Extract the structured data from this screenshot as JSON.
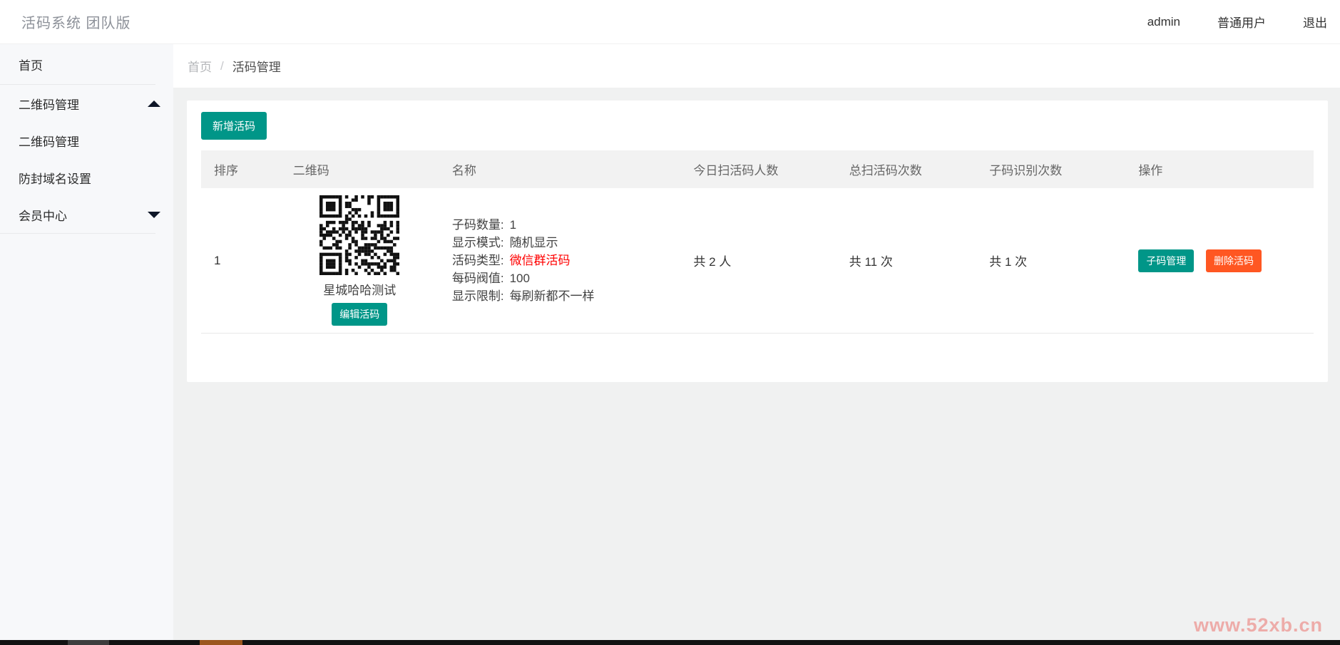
{
  "header": {
    "title": "活码系统 团队版",
    "username": "admin",
    "role": "普通用户",
    "logout": "退出"
  },
  "sidebar": {
    "items": [
      {
        "label": "首页"
      },
      {
        "label": "二维码管理",
        "arrow": "up"
      },
      {
        "label": "二维码管理"
      },
      {
        "label": "防封域名设置"
      },
      {
        "label": "会员中心",
        "arrow": "down"
      }
    ]
  },
  "breadcrumb": {
    "home": "首页",
    "separator": "/",
    "current": "活码管理"
  },
  "toolbar": {
    "add_button": "新增活码"
  },
  "table": {
    "headers": [
      "排序",
      "二维码",
      "名称",
      "今日扫活码人数",
      "总扫活码次数",
      "子码识别次数",
      "操作"
    ],
    "rows": [
      {
        "order": "1",
        "qr": {
          "label": "星城哈哈测试",
          "edit_button": "编辑活码"
        },
        "details": [
          {
            "label": "子码数量:",
            "value": "1"
          },
          {
            "label": "显示模式:",
            "value": "随机显示"
          },
          {
            "label": "活码类型:",
            "value": "微信群活码",
            "highlight": true
          },
          {
            "label": "每码阀值:",
            "value": "100"
          },
          {
            "label": "显示限制:",
            "value": "每刷新都不一样"
          }
        ],
        "today_scans": "共 2 人",
        "total_scans": "共 11 次",
        "subcode_scans": "共 1 次",
        "actions": {
          "manage": "子码管理",
          "delete": "删除活码"
        }
      }
    ]
  },
  "watermark": {
    "text": "www.52xb.cn"
  },
  "colors": {
    "primary": "#009688",
    "danger": "#ff5722",
    "type_highlight": "#ff0000",
    "watermark": "#edaca9",
    "taskbar_accent": "#9c561e"
  }
}
